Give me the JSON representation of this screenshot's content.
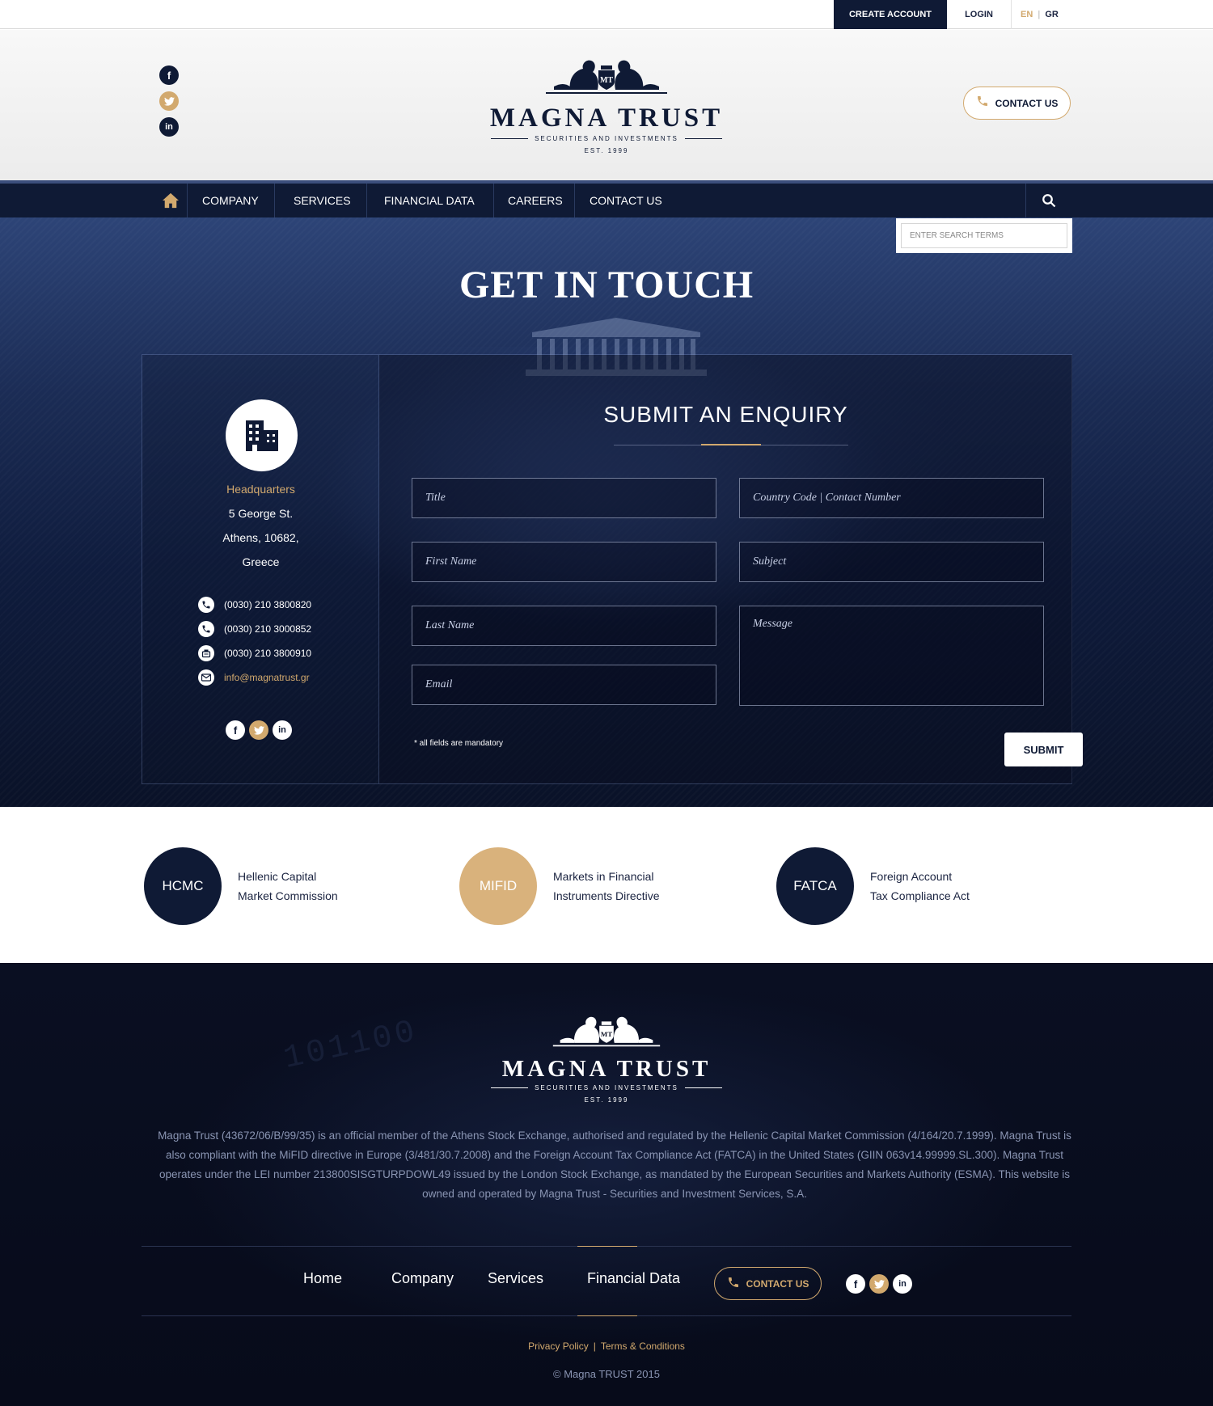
{
  "topbar": {
    "create_account": "CREATE ACCOUNT",
    "login": "LOGIN",
    "lang_en": "EN",
    "lang_gr": "GR"
  },
  "brand": {
    "name": "MAGNA TRUST",
    "tagline": "SECURITIES AND INVESTMENTS",
    "est": "EST. 1999"
  },
  "header": {
    "contact_us": "CONTACT US"
  },
  "nav": {
    "items": [
      "COMPANY",
      "SERVICES",
      "FINANCIAL DATA",
      "CAREERS",
      "CONTACT US"
    ]
  },
  "search": {
    "placeholder": "ENTER SEARCH TERMS"
  },
  "hero": {
    "title": "GET IN TOUCH"
  },
  "hq": {
    "title": "Headquarters",
    "address": [
      "5 George St.",
      "Athens, 10682,",
      "Greece"
    ],
    "phone1": "(0030) 210 3800820",
    "phone2": "(0030) 210 3000852",
    "fax": "(0030) 210 3800910",
    "email": "info@magnatrust.gr"
  },
  "enquiry": {
    "title": "SUBMIT AN ENQUIRY",
    "fields": {
      "title": "Title",
      "contact_number": "Country Code | Contact Number",
      "first_name": "First Name",
      "subject": "Subject",
      "last_name": "Last Name",
      "message": "Message",
      "email": "Email"
    },
    "mandatory_note": "* all fields are mandatory",
    "submit": "SUBMIT"
  },
  "regulators": [
    {
      "abbr": "HCMC",
      "line1": "Hellenic Capital",
      "line2": "Market Commission",
      "color": "#0f1a35"
    },
    {
      "abbr": "MIFID",
      "line1": "Markets in Financial",
      "line2": "Instruments Directive",
      "color": "#d9b27c"
    },
    {
      "abbr": "FATCA",
      "line1": "Foreign Account",
      "line2": "Tax Compliance Act",
      "color": "#0f1a35"
    }
  ],
  "footer": {
    "disclaimer": "Magna Trust (43672/06/B/99/35) is an official member of the Athens Stock Exchange, authorised and regulated by the Hellenic Capital Market Commission (4/164/20.7.1999). Magna Trust is also compliant with the MiFID directive in Europe (3/481/30.7.2008) and the Foreign Account Tax Compliance Act (FATCA) in the United States (GIIN 063v14.99999.SL.300). Magna Trust operates under the LEI number 213800SISGTURPDOWL49 issued by the London Stock Exchange, as mandated by the European Securities and Markets Authority (ESMA). This website is owned and operated by Magna Trust - Securities and Investment Services, S.A.",
    "nav": [
      "Home",
      "Company",
      "Services",
      "Financial Data"
    ],
    "contact_us": "CONTACT US",
    "privacy": "Privacy Policy",
    "terms": "Terms & Conditions",
    "copyright": "© Magna TRUST 2015"
  },
  "colors": {
    "navy": "#0f1a35",
    "gold": "#d2a96e"
  },
  "icons": {
    "home": "home-icon",
    "search": "search-icon",
    "phone": "phone-icon",
    "fax": "fax-icon",
    "mail": "mail-icon",
    "building": "building-icon"
  }
}
